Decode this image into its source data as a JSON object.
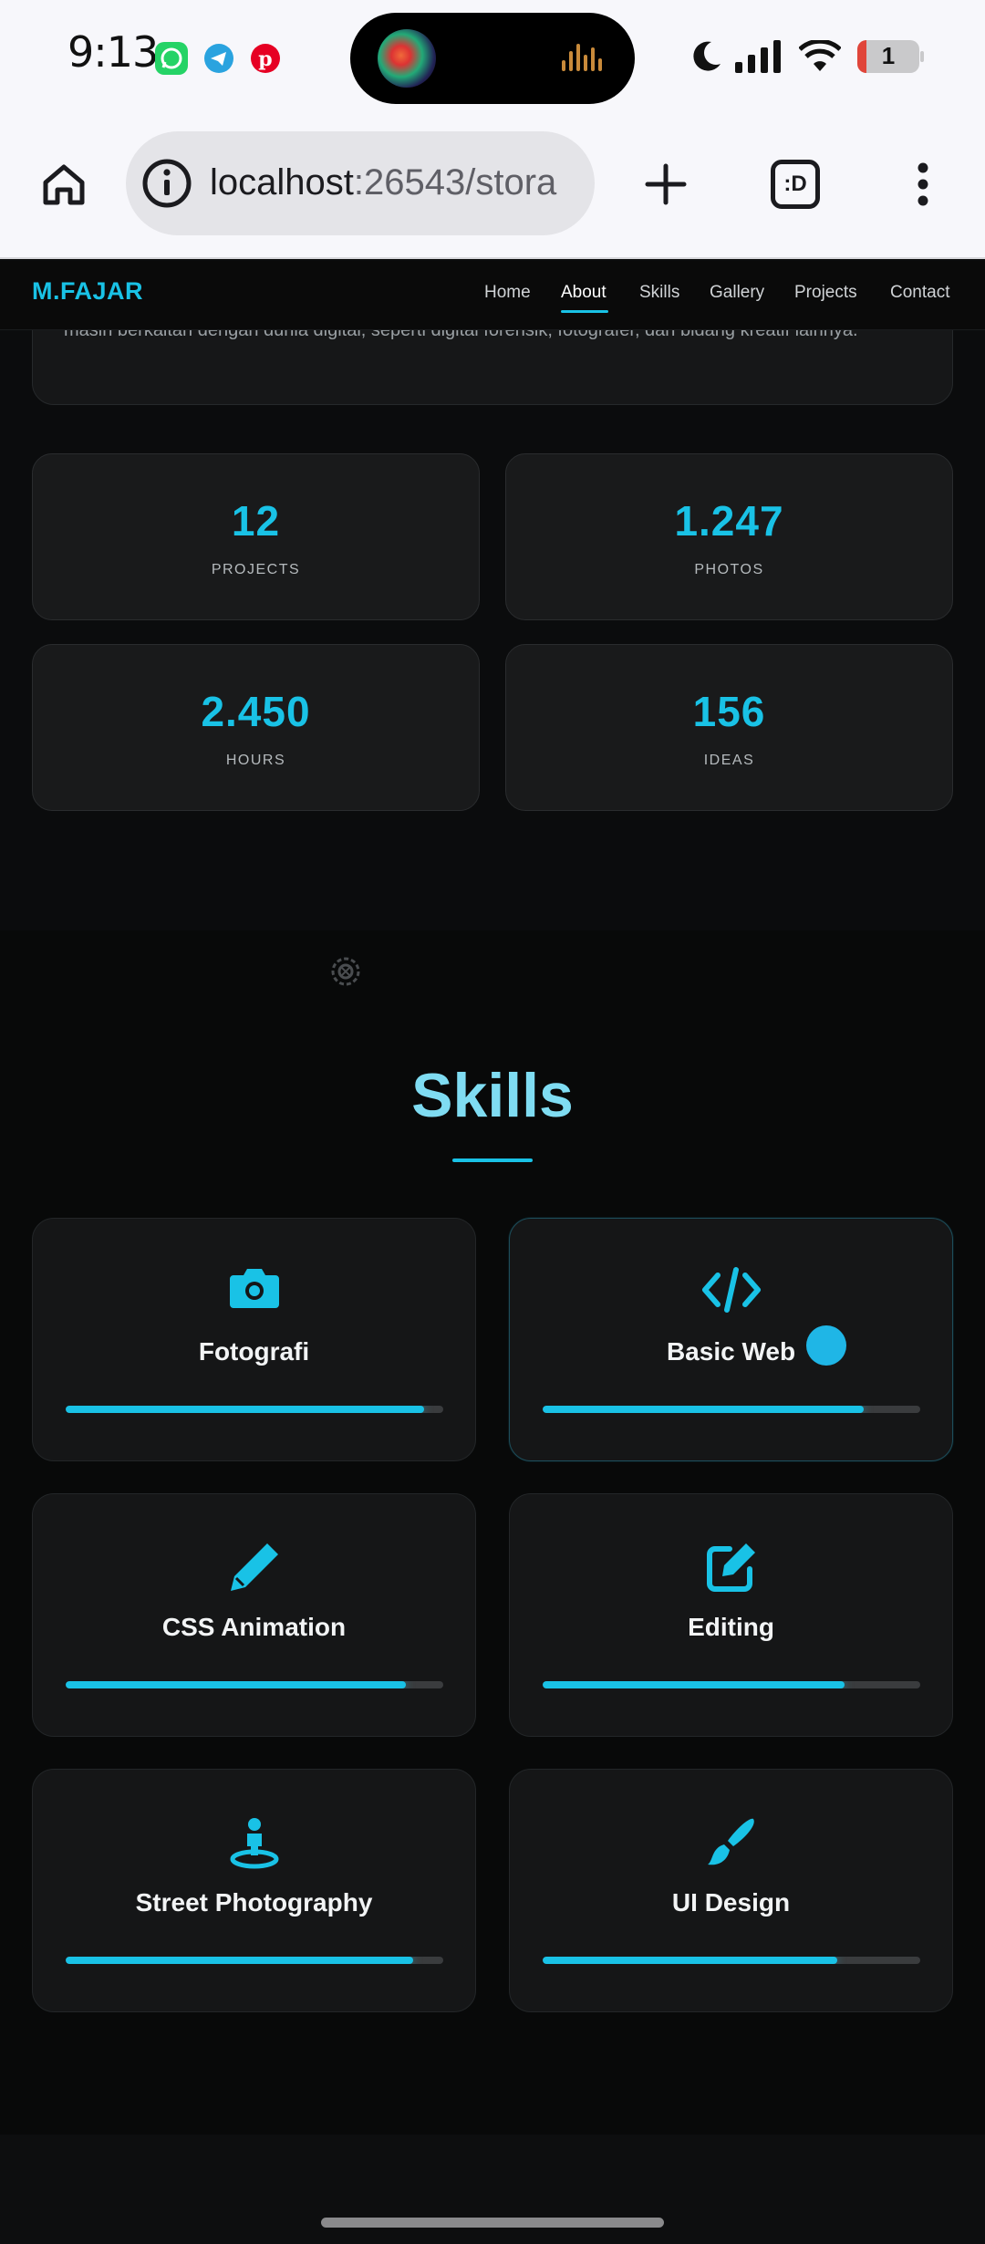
{
  "status_bar": {
    "time": "9:13",
    "battery": "1",
    "notification_apps": [
      "whatsapp-icon",
      "telegram-icon",
      "pinterest-icon"
    ]
  },
  "browser": {
    "url_host": "localhost",
    "url_rest": ":26543/stora",
    "tab_count_label": ":D"
  },
  "site": {
    "logo": "M.FAJAR",
    "nav": [
      {
        "label": "Home",
        "active": false
      },
      {
        "label": "About",
        "active": true
      },
      {
        "label": "Skills",
        "active": false
      },
      {
        "label": "Gallery",
        "active": false
      },
      {
        "label": "Projects",
        "active": false
      },
      {
        "label": "Contact",
        "active": false
      }
    ],
    "accent_color": "#19c2e6"
  },
  "about": {
    "partial_text": "masih berkaitan dengan dunia digital, seperti digital forensik, fotografer, dan bidang kreatif lainnya."
  },
  "stats": [
    {
      "value": "12",
      "label": "PROJECTS"
    },
    {
      "value": "1.247",
      "label": "PHOTOS"
    },
    {
      "value": "2.450",
      "label": "HOURS"
    },
    {
      "value": "156",
      "label": "IDEAS"
    }
  ],
  "skills": {
    "title": "Skills",
    "items": [
      {
        "name": "Fotografi",
        "icon": "camera-icon",
        "level": 0.95
      },
      {
        "name": "Basic Web",
        "icon": "code-icon",
        "level": 0.85
      },
      {
        "name": "CSS Animation",
        "icon": "pen-icon",
        "level": 0.9
      },
      {
        "name": "Editing",
        "icon": "edit-icon",
        "level": 0.8
      },
      {
        "name": "Street Photography",
        "icon": "street-view-icon",
        "level": 0.92
      },
      {
        "name": "UI Design",
        "icon": "brush-icon",
        "level": 0.78
      }
    ]
  }
}
